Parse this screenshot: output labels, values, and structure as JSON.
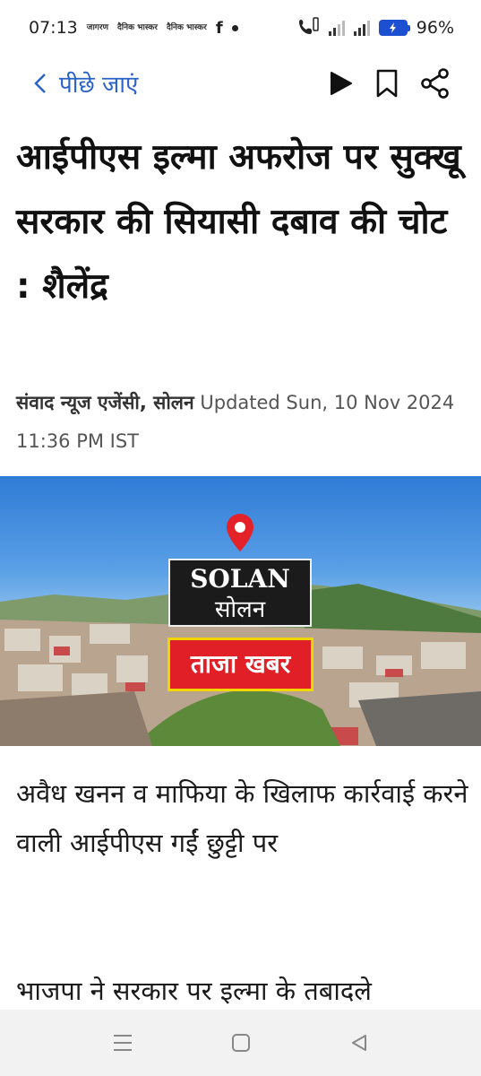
{
  "status": {
    "time": "07:13",
    "notifications": [
      "जागरण",
      "दैनिक भास्कर",
      "दैनिक भास्कर"
    ],
    "battery": "96%"
  },
  "topnav": {
    "back_label": "पीछे जाएं",
    "icons": [
      "play-icon",
      "bookmark-icon",
      "share-icon"
    ]
  },
  "article": {
    "headline": "आईपीएस इल्मा अफरोज पर सुक्खू सरकार की सियासी दबाव की चोट : शैलेंद्र",
    "byline_author": "संवाद न्यूज एजेंसी, सोलन",
    "byline_updated": "Updated Sun, 10 Nov 2024 11:36 PM IST",
    "image": {
      "label_en": "SOLAN",
      "label_hi": "सोलन",
      "badge": "ताजा खबर"
    },
    "paragraphs": [
      "अवैध खनन व माफिया के खिलाफ कार्रवाई करने वाली आईपीएस गईं छुट्टी पर",
      "भाजपा ने सरकार पर इल्मा के तबादले"
    ]
  },
  "colors": {
    "accent": "#2962c9",
    "badge_red": "#e01f26",
    "badge_border": "#f2d600"
  },
  "system_nav": [
    "menu-icon",
    "home-icon",
    "back-icon"
  ]
}
